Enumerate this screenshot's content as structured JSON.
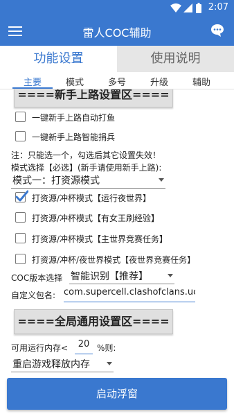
{
  "status_bar": {
    "time": "2:07"
  },
  "app_bar": {
    "title": "雷人COC辅助"
  },
  "top_tabs": [
    {
      "label": "功能设置"
    },
    {
      "label": "使用说明"
    }
  ],
  "sub_tabs": [
    {
      "label": "主要"
    },
    {
      "label": "模式"
    },
    {
      "label": "多号"
    },
    {
      "label": "升级"
    },
    {
      "label": "辅助"
    }
  ],
  "sections": {
    "newbie": "====新手上路设置区====",
    "global": "====全局通用设置区===="
  },
  "newbie_options": [
    {
      "label": "一键新手上路自动打鱼",
      "checked": false
    },
    {
      "label": "一键新手上路智能捐兵",
      "checked": false
    }
  ],
  "note": "注：只能选一个，勾选后其它设置失效！",
  "mode_label": "模式选择【必选】(新手请使用新手上路):",
  "mode_select": {
    "value": "模式一：打资源模式"
  },
  "mode_options": [
    {
      "label": "打资源/冲杯模式【运行夜世界】",
      "checked": true
    },
    {
      "label": "打资源/冲杯模式【有女王刷经验】",
      "checked": false
    },
    {
      "label": "打资源/冲杯模式【主世界竞赛任务】",
      "checked": false
    },
    {
      "label": "打资源/冲杯/夜世界模式【夜世界竞赛任务】",
      "checked": false
    }
  ],
  "version": {
    "label": "COC版本选择",
    "value": "智能识别【推荐】"
  },
  "package": {
    "label": "自定义包名:",
    "value": "com.supercell.clashofclans.uc"
  },
  "memory": {
    "label_prefix": "可用运行内存<",
    "value": "20",
    "label_suffix": "%则:"
  },
  "memory_action": {
    "value": "重启游戏释放内存"
  },
  "start_button": {
    "label": "启动浮窗"
  },
  "colors": {
    "accent": "#3a78cf",
    "tab_inactive_bg": "#e6e6e6",
    "section_button_bg": "#e0e0e0"
  }
}
